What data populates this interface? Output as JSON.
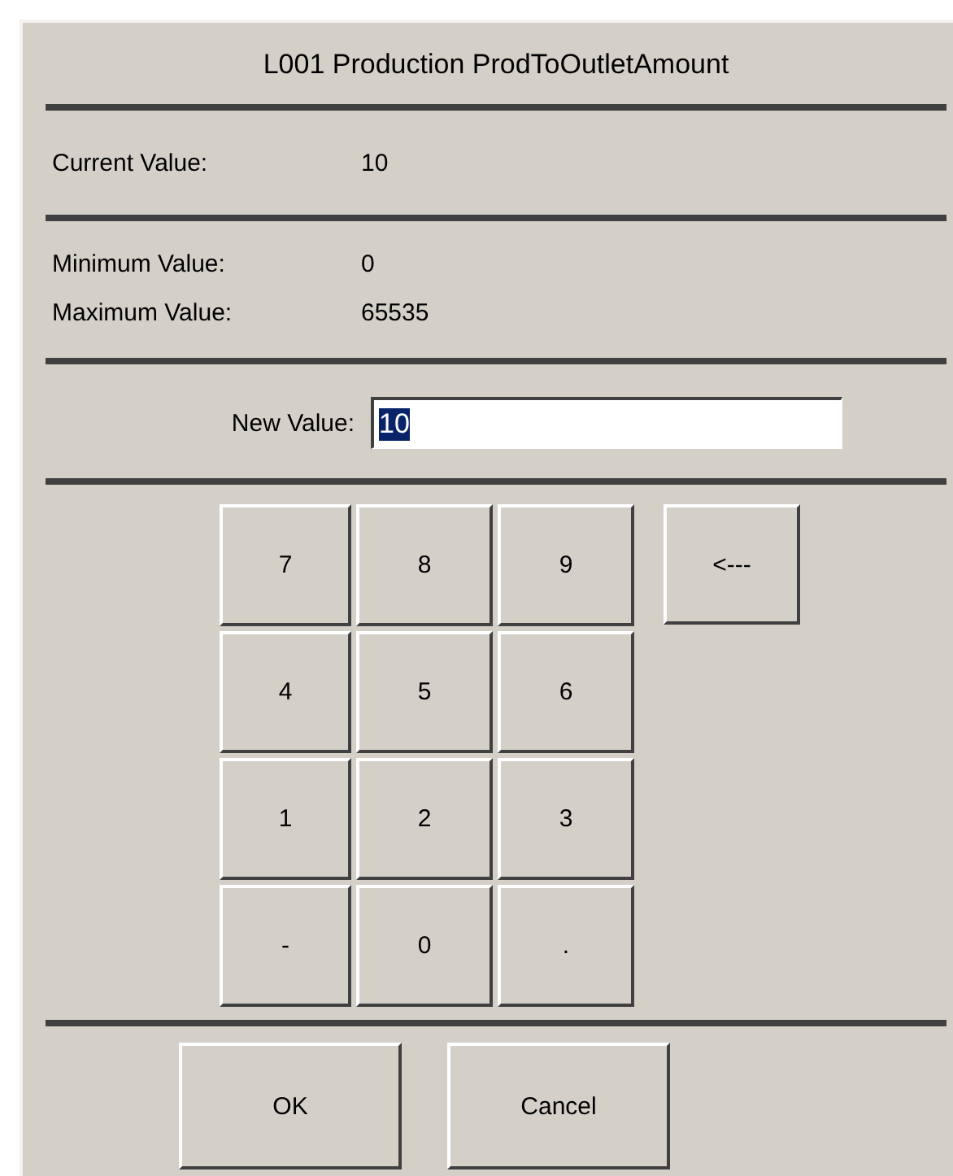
{
  "dialog": {
    "title": "L001 Production ProdToOutletAmount"
  },
  "current": {
    "label": "Current Value:",
    "value": "10"
  },
  "limits": [
    {
      "label": "Minimum Value:",
      "value": "0"
    },
    {
      "label": "Maximum Value:",
      "value": "65535"
    }
  ],
  "new_value": {
    "label": "New Value:",
    "value": "10",
    "text_selected": true
  },
  "keypad": [
    [
      "7",
      "8",
      "9"
    ],
    [
      "4",
      "5",
      "6"
    ],
    [
      "1",
      "2",
      "3"
    ],
    [
      "-",
      "0",
      "."
    ]
  ],
  "backspace": "<---",
  "buttons": [
    "OK",
    "Cancel"
  ]
}
